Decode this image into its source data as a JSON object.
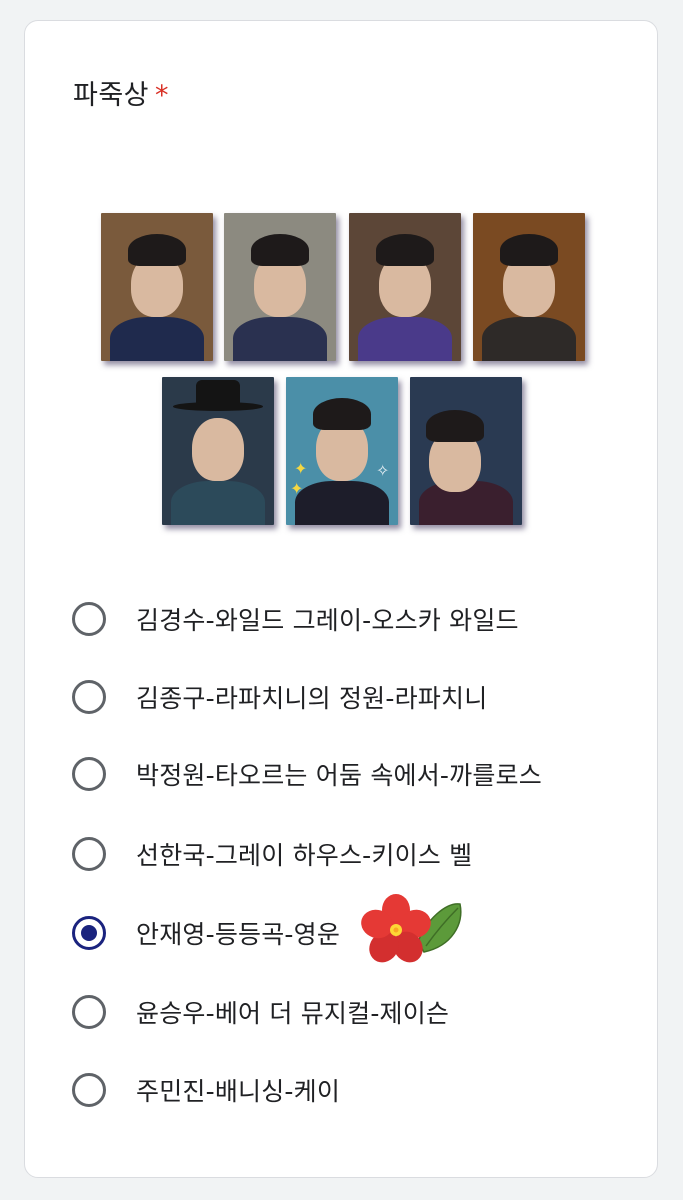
{
  "question": {
    "title": "파죽상",
    "required_mark": "*"
  },
  "photos": [
    {
      "name": "photo-1",
      "bg": "#7a5a3c",
      "outfit": "#1f2a4d"
    },
    {
      "name": "photo-2",
      "bg": "#8c8a80",
      "outfit": "#2a3150"
    },
    {
      "name": "photo-3",
      "bg": "#5c4637",
      "outfit": "#4a3a8a"
    },
    {
      "name": "photo-4",
      "bg": "#7a4a22",
      "outfit": "#2e2a28"
    },
    {
      "name": "photo-5",
      "bg": "#2b3a4a",
      "outfit": "#2c4a5a"
    },
    {
      "name": "photo-6",
      "bg": "#4b8fa8",
      "outfit": "#1d1d2a"
    },
    {
      "name": "photo-7",
      "bg": "#2a3a52",
      "outfit": "#3a1f2e"
    }
  ],
  "options": [
    {
      "label": "김경수-와일드 그레이-오스카 와일드",
      "checked": false
    },
    {
      "label": "김종구-라파치니의 정원-라파치니",
      "checked": false
    },
    {
      "label": "박정원-타오르는 어둠 속에서-까를로스",
      "checked": false
    },
    {
      "label": "선한국-그레이 하우스-키이스 벨",
      "checked": false
    },
    {
      "label": "안재영-등등곡-영운",
      "checked": true
    },
    {
      "label": "윤승우-베어 더 뮤지컬-제이슨",
      "checked": false
    },
    {
      "label": "주민진-배니싱-케이",
      "checked": false
    }
  ],
  "colors": {
    "accent": "#1a237e",
    "required": "#d93025",
    "radio_border": "#5f6368"
  },
  "icons": {
    "sticker": "flower-sticker-icon"
  }
}
